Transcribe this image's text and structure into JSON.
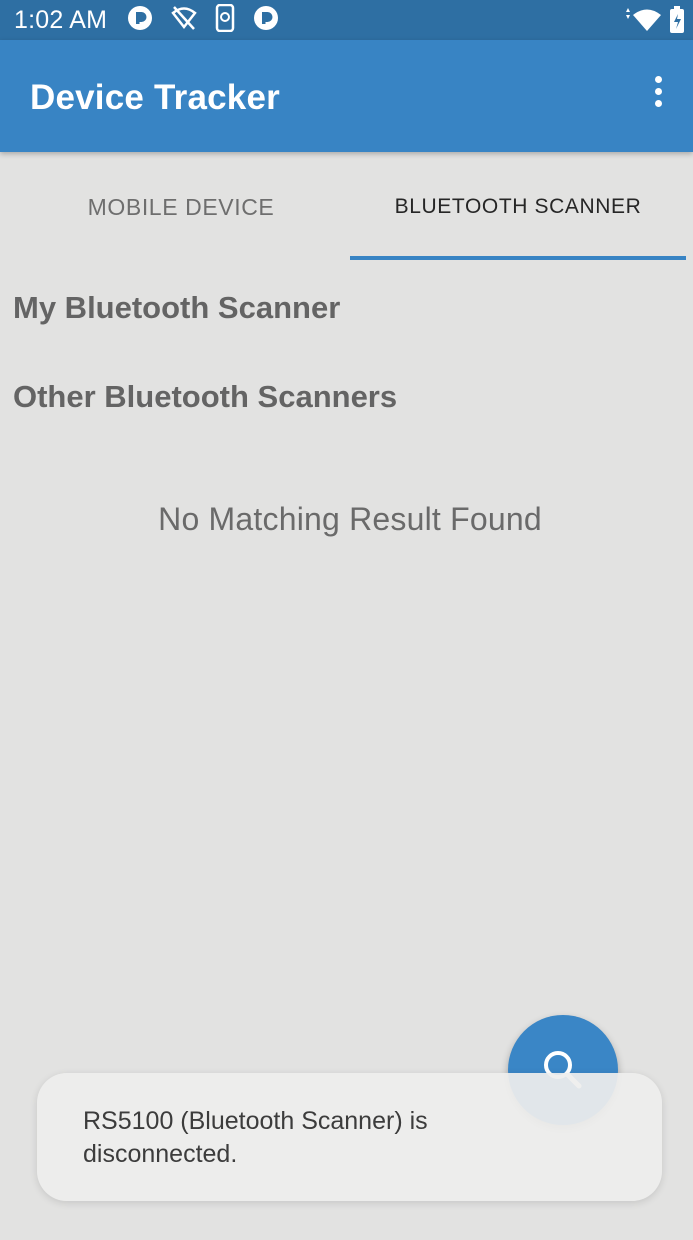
{
  "status_bar": {
    "time": "1:02 AM",
    "icons_left": [
      "app-notification-icon",
      "wifi-off-icon",
      "phone-battery-icon",
      "app-notification-icon"
    ],
    "icons_right": [
      "wifi-icon",
      "battery-icon"
    ]
  },
  "app_bar": {
    "title": "Device Tracker",
    "menu_icon": "more-vert-icon"
  },
  "tabs": [
    {
      "label": "MOBILE DEVICE",
      "selected": false
    },
    {
      "label": "BLUETOOTH SCANNER",
      "selected": true
    }
  ],
  "sections": {
    "my_scanner": "My Bluetooth Scanner",
    "other_scanners": "Other Bluetooth Scanners"
  },
  "empty_message": "No Matching Result Found",
  "fab": {
    "icon": "search-icon"
  },
  "toast": {
    "message": "RS5100 (Bluetooth Scanner) is disconnected."
  },
  "colors": {
    "app_bar": "#3884c4",
    "status_bar": "#2e6fa3",
    "background": "#e2e2e1",
    "tab_indicator": "#3884c4",
    "fab": "#3a86c6"
  }
}
